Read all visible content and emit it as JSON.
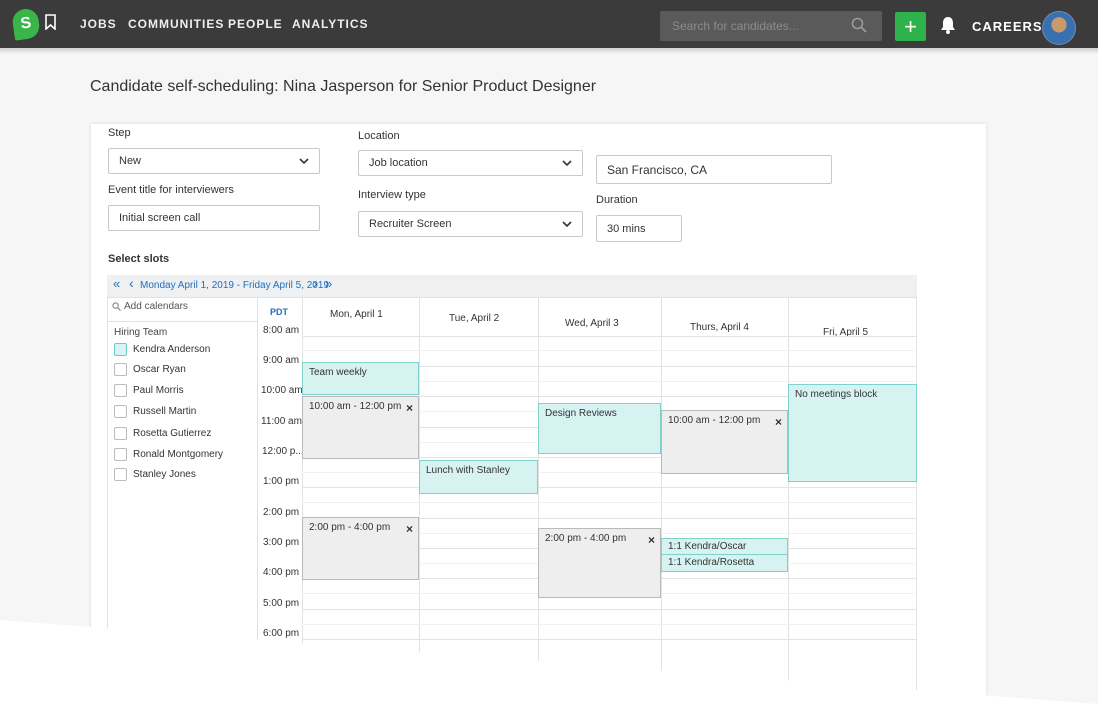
{
  "topbar": {
    "logo_letter": "S",
    "nav": [
      "JOBS",
      "COMMUNITIES",
      "PEOPLE",
      "ANALYTICS"
    ],
    "search_placeholder": "Search for candidates...",
    "add_label": "+",
    "careers_label": "CAREERS"
  },
  "page": {
    "title": "Candidate self-scheduling: Nina Jasperson for Senior Product Designer"
  },
  "form": {
    "step_label": "Step",
    "step_value": "New",
    "event_title_label": "Event title for interviewers",
    "event_title_value": "Initial screen call",
    "location_label": "Location",
    "location_value": "Job location",
    "location_text": "San Francisco, CA",
    "interview_type_label": "Interview type",
    "interview_type_value": "Recruiter Screen",
    "duration_label": "Duration",
    "duration_value": "30 mins"
  },
  "calendar": {
    "section_title": "Select slots",
    "nav_first": "«",
    "nav_prev": "‹",
    "date_range": "Monday April 1, 2019 - Friday April 5, 2019",
    "nav_next": "›",
    "nav_last": "»",
    "add_calendars_placeholder": "Add calendars",
    "hiring_team_label": "Hiring Team",
    "team": [
      {
        "name": "Kendra Anderson",
        "checked": true
      },
      {
        "name": "Oscar Ryan",
        "checked": false
      },
      {
        "name": "Paul Morris",
        "checked": false
      },
      {
        "name": "Russell Martin",
        "checked": false
      },
      {
        "name": "Rosetta Gutierrez",
        "checked": false
      },
      {
        "name": "Ronald Montgomery",
        "checked": false
      },
      {
        "name": "Stanley Jones",
        "checked": false
      }
    ],
    "timezone": "PDT",
    "days": [
      "Mon, April 1",
      "Tue, April 2",
      "Wed, April 3",
      "Thurs, April 4",
      "Fri, April 5"
    ],
    "times": [
      "8:00 am",
      "9:00 am",
      "10:00 am",
      "11:00 am",
      "12:00 p...",
      "1:00 pm",
      "2:00 pm",
      "3:00 pm",
      "4:00 pm",
      "5:00 pm",
      "6:00 pm"
    ],
    "events": [
      {
        "label": "Team weekly",
        "kind": "busy"
      },
      {
        "label": "10:00 am - 12:00 pm",
        "kind": "slot",
        "close": "×"
      },
      {
        "label": "2:00 pm - 4:00 pm",
        "kind": "slot",
        "close": "×"
      },
      {
        "label": "Lunch with Stanley",
        "kind": "busy"
      },
      {
        "label": "Design Reviews",
        "kind": "busy"
      },
      {
        "label": "2:00 pm - 4:00 pm",
        "kind": "slot",
        "close": "×"
      },
      {
        "label": "10:00 am - 12:00 pm",
        "kind": "slot",
        "close": "×"
      },
      {
        "label": "1:1 Kendra/Oscar",
        "kind": "busy"
      },
      {
        "label": "1:1 Kendra/Rosetta",
        "kind": "busy"
      },
      {
        "label": "No meetings block",
        "kind": "busy"
      }
    ]
  },
  "colors": {
    "topbar": "#3b3b3b",
    "accent_green": "#2fb14c",
    "busy_fill": "#d6f3f1",
    "slot_fill": "#eeeeee",
    "link_blue": "#1e6fc0"
  }
}
